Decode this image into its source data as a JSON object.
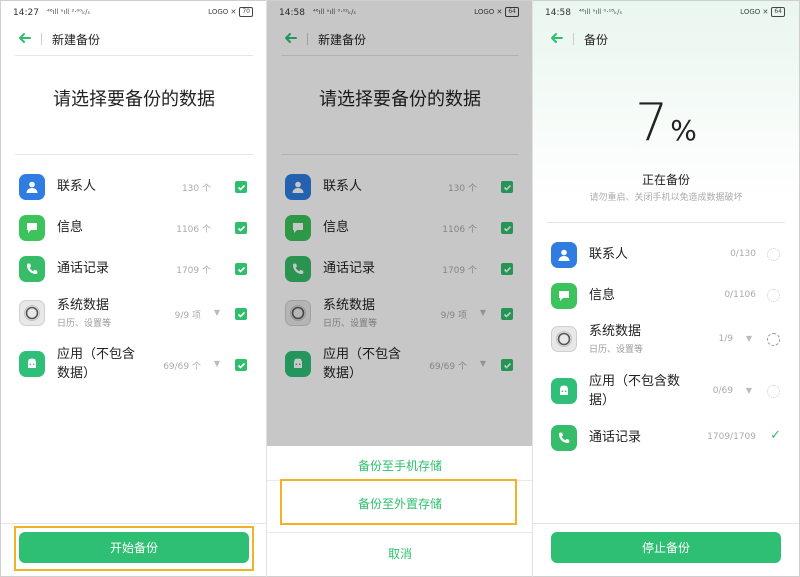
{
  "colors": {
    "accent": "#2fbf6c",
    "highlight": "#f1b324"
  },
  "screens": [
    {
      "status": {
        "time": "14:27",
        "sig": "⁴⁶ıll ᵃıll ²·⁰⁰ₖ/ₛ",
        "right": "LOGO ✕",
        "battery": "70"
      },
      "header": {
        "title": "新建备份"
      },
      "heading": "请选择要备份的数据",
      "items": [
        {
          "label": "联系人",
          "count": "130 个"
        },
        {
          "label": "信息",
          "count": "1106 个"
        },
        {
          "label": "通话记录",
          "count": "1709 个"
        },
        {
          "label": "系统数据",
          "sub": "日历、设置等",
          "count": "9/9 项"
        },
        {
          "label": "应用（不包含",
          "label2": "数据）",
          "count": "69/69 个"
        }
      ],
      "button": "开始备份"
    },
    {
      "status": {
        "time": "14:58",
        "sig": "⁴⁶ıll ᵃıll ⁰·⁰²ₖ/ₛ",
        "right": "LOGO ✕",
        "battery": "64"
      },
      "header": {
        "title": "新建备份"
      },
      "heading": "请选择要备份的数据",
      "items": [
        {
          "label": "联系人",
          "count": "130 个"
        },
        {
          "label": "信息",
          "count": "1106 个"
        },
        {
          "label": "通话记录",
          "count": "1709 个"
        },
        {
          "label": "系统数据",
          "sub": "日历、设置等",
          "count": "9/9 项"
        },
        {
          "label": "应用（不包含",
          "label2": "数据）",
          "count": "69/69 个"
        }
      ],
      "sheet": {
        "option1": "备份至手机存储",
        "option2": "备份至外置存储",
        "cancel": "取消"
      }
    },
    {
      "status": {
        "time": "14:58",
        "sig": "⁴⁶ıll ᵃıll ⁰·¹⁸ₖ/ₛ",
        "right": "LOGO ✕",
        "battery": "64"
      },
      "header": {
        "title": "备份"
      },
      "progress": {
        "value": "7",
        "unit": "%",
        "title": "正在备份",
        "desc": "请勿重启、关闭手机以免造成数据破坏"
      },
      "items": [
        {
          "label": "联系人",
          "count": "0/130"
        },
        {
          "label": "信息",
          "count": "0/1106"
        },
        {
          "label": "系统数据",
          "sub": "日历、设置等",
          "count": "1/9"
        },
        {
          "label": "应用（不包含数",
          "label2": "据）",
          "count": "0/69"
        },
        {
          "label": "通话记录",
          "count": "1709/1709"
        }
      ],
      "button": "停止备份"
    }
  ]
}
